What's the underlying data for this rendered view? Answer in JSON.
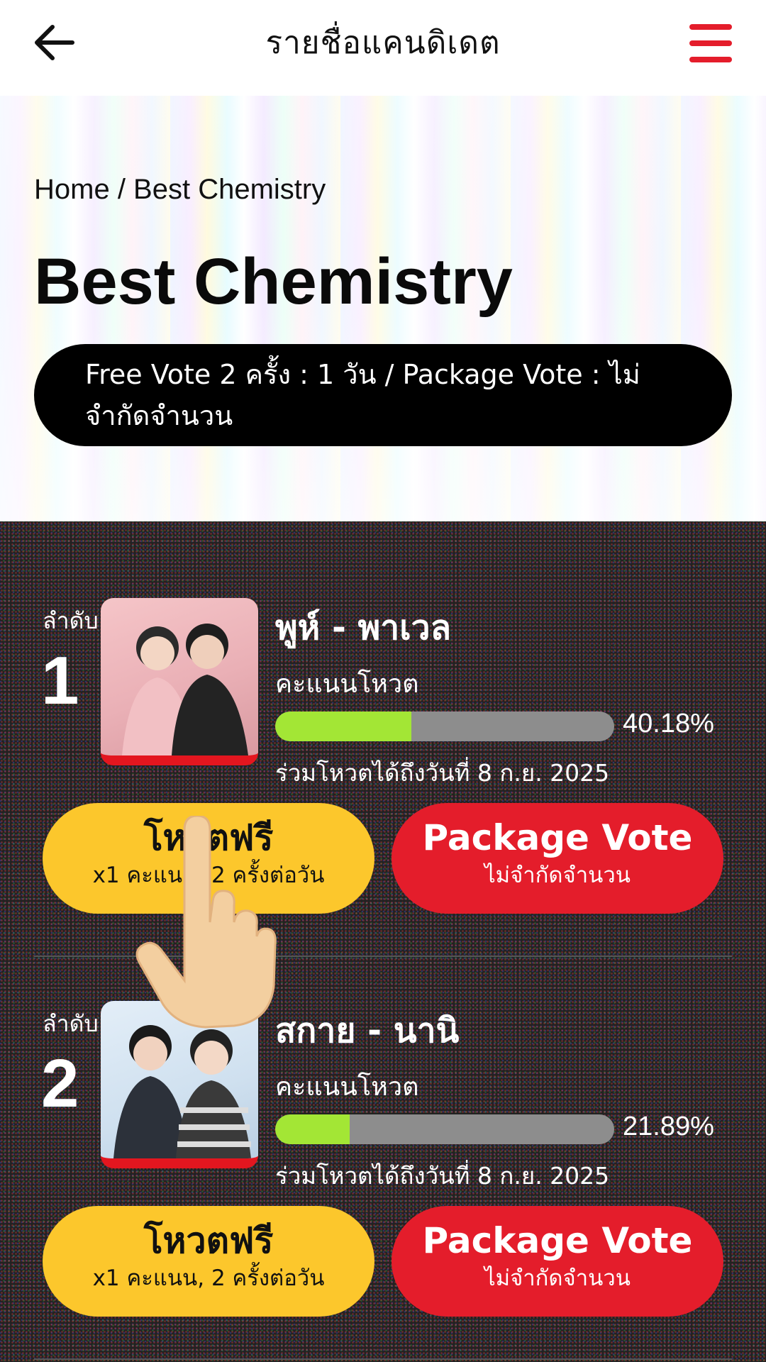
{
  "header": {
    "title": "รายชื่อแคนดิเดต",
    "back_icon": "arrow-left-icon",
    "menu_icon": "hamburger-menu-icon",
    "menu_color": "#e41d2b"
  },
  "hero": {
    "breadcrumb": "Home / Best Chemistry",
    "title": "Best Chemistry",
    "vote_info_line1": "Free Vote 2 ครั้ง : 1 วัน / Package Vote : ไม่",
    "vote_info_line2": "จำกัดจำนวน"
  },
  "candidates": [
    {
      "rank_label": "ลำดับ",
      "rank": "1",
      "name": "พูห์ - พาเวล",
      "score_label": "คะแนนโหวต",
      "percent_value": 40.18,
      "percent_text": "40.18%",
      "deadline": "ร่วมโหวตได้ถึงวันที่ 8 ก.ย. 2025",
      "free_vote_title": "โหวตฟรี",
      "free_vote_sub": "x1 คะแนน, 2 ครั้งต่อวัน",
      "package_title": "Package Vote",
      "package_sub": "ไม่จำกัดจำนวน"
    },
    {
      "rank_label": "ลำดับ",
      "rank": "2",
      "name": "สกาย - นานิ",
      "score_label": "คะแนนโหวต",
      "percent_value": 21.89,
      "percent_text": "21.89%",
      "deadline": "ร่วมโหวตได้ถึงวันที่ 8 ก.ย. 2025",
      "free_vote_title": "โหวตฟรี",
      "free_vote_sub": "x1 คะแนน, 2 ครั้งต่อวัน",
      "package_title": "Package Vote",
      "package_sub": "ไม่จำกัดจำนวน"
    }
  ],
  "colors": {
    "free_button": "#fcc72c",
    "package_button": "#e41d2b",
    "progress_fill": "#a3e635",
    "progress_track": "#8d8d8d"
  }
}
